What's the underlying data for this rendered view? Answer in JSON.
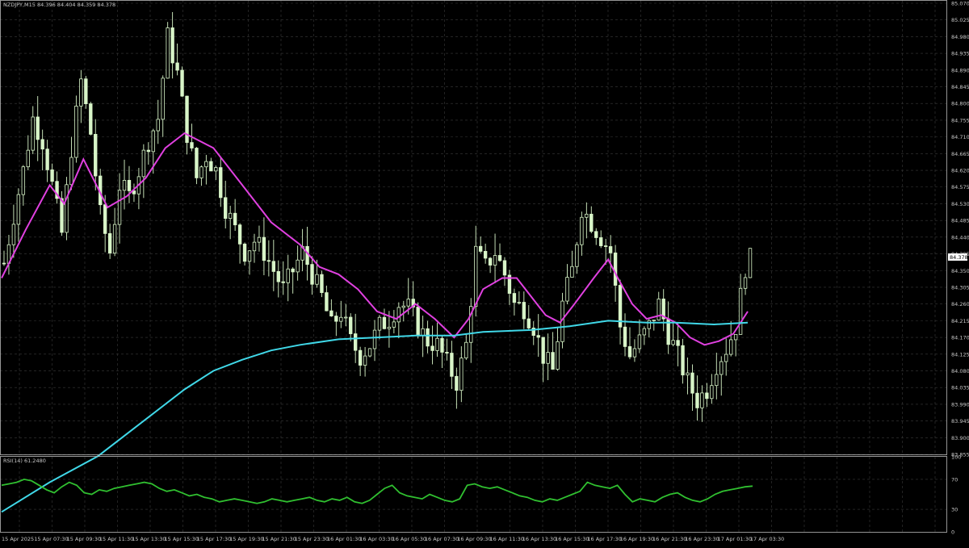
{
  "symbol_header": "NZDJPY,M15  84.396 84.404 84.359 84.378",
  "rsi_header": "RSI(14) 61.2480",
  "current_price_label": "84.378",
  "colors": {
    "background": "#000000",
    "candle": "#d8f5c8",
    "ma_fast": "#e040e0",
    "ma_slow": "#40d8e8",
    "rsi_line": "#30c030",
    "grid": "#3a3a3a"
  },
  "chart_data": [
    {
      "type": "candlestick",
      "title": "NZDJPY,M15",
      "ylim": [
        83.855,
        85.07
      ],
      "y_ticks": [
        "85.070",
        "85.025",
        "84.980",
        "84.935",
        "84.890",
        "84.845",
        "84.800",
        "84.755",
        "84.710",
        "84.665",
        "84.620",
        "84.575",
        "84.530",
        "84.485",
        "84.440",
        "84.395",
        "84.350",
        "84.305",
        "84.260",
        "84.215",
        "84.170",
        "84.125",
        "84.080",
        "84.035",
        "83.990",
        "83.945",
        "83.900",
        "83.855"
      ],
      "x_ticks": [
        "15 Apr 2025",
        "15 Apr 07:30",
        "15 Apr 09:30",
        "15 Apr 11:30",
        "15 Apr 13:30",
        "15 Apr 15:30",
        "15 Apr 17:30",
        "15 Apr 19:30",
        "15 Apr 21:30",
        "15 Apr 23:30",
        "16 Apr 01:30",
        "16 Apr 03:30",
        "16 Apr 05:30",
        "16 Apr 07:30",
        "16 Apr 09:30",
        "16 Apr 11:30",
        "16 Apr 13:30",
        "16 Apr 15:30",
        "16 Apr 17:30",
        "16 Apr 19:30",
        "16 Apr 21:30",
        "16 Apr 23:30",
        "17 Apr 01:30",
        "17 Apr 03:30"
      ],
      "close_path": [
        [
          0,
          84.37
        ],
        [
          2,
          84.5
        ],
        [
          4,
          84.62
        ],
        [
          6,
          84.76
        ],
        [
          8,
          84.7
        ],
        [
          10,
          84.58
        ],
        [
          12,
          84.45
        ],
        [
          14,
          84.68
        ],
        [
          16,
          84.86
        ],
        [
          18,
          84.72
        ],
        [
          20,
          84.5
        ],
        [
          22,
          84.4
        ],
        [
          24,
          84.58
        ],
        [
          26,
          84.55
        ],
        [
          28,
          84.62
        ],
        [
          30,
          84.7
        ],
        [
          32,
          84.76
        ],
        [
          34,
          84.98
        ],
        [
          36,
          84.88
        ],
        [
          38,
          84.72
        ],
        [
          40,
          84.6
        ],
        [
          42,
          84.66
        ],
        [
          44,
          84.62
        ],
        [
          46,
          84.52
        ],
        [
          48,
          84.46
        ],
        [
          50,
          84.4
        ],
        [
          52,
          84.43
        ],
        [
          54,
          84.4
        ],
        [
          56,
          84.35
        ],
        [
          58,
          84.3
        ],
        [
          60,
          84.35
        ],
        [
          62,
          84.4
        ],
        [
          64,
          84.34
        ],
        [
          66,
          84.28
        ],
        [
          68,
          84.2
        ],
        [
          70,
          84.24
        ],
        [
          72,
          84.16
        ],
        [
          74,
          84.12
        ],
        [
          76,
          84.15
        ],
        [
          78,
          84.2
        ],
        [
          80,
          84.22
        ],
        [
          82,
          84.26
        ],
        [
          84,
          84.25
        ],
        [
          86,
          84.2
        ],
        [
          88,
          84.16
        ],
        [
          90,
          84.15
        ],
        [
          92,
          84.1
        ],
        [
          94,
          84.05
        ],
        [
          96,
          84.15
        ],
        [
          98,
          84.4
        ],
        [
          100,
          84.36
        ],
        [
          102,
          84.4
        ],
        [
          104,
          84.34
        ],
        [
          106,
          84.26
        ],
        [
          108,
          84.25
        ],
        [
          110,
          84.2
        ],
        [
          112,
          84.12
        ],
        [
          114,
          84.08
        ],
        [
          116,
          84.26
        ],
        [
          118,
          84.35
        ],
        [
          120,
          84.52
        ],
        [
          122,
          84.48
        ],
        [
          124,
          84.44
        ],
        [
          126,
          84.4
        ],
        [
          128,
          84.2
        ],
        [
          130,
          84.12
        ],
        [
          132,
          84.16
        ],
        [
          134,
          84.2
        ],
        [
          136,
          84.26
        ],
        [
          138,
          84.18
        ],
        [
          140,
          84.12
        ],
        [
          142,
          84.05
        ],
        [
          144,
          84.0
        ],
        [
          146,
          84.03
        ],
        [
          148,
          84.1
        ],
        [
          150,
          84.14
        ],
        [
          152,
          84.2
        ],
        [
          154,
          84.36
        ],
        [
          156,
          84.4
        ]
      ],
      "series": [
        {
          "name": "ma_fast",
          "points": [
            [
              0,
              84.33
            ],
            [
              5,
              84.46
            ],
            [
              10,
              84.58
            ],
            [
              13,
              84.53
            ],
            [
              17,
              84.65
            ],
            [
              22,
              84.52
            ],
            [
              26,
              84.55
            ],
            [
              30,
              84.6
            ],
            [
              34,
              84.68
            ],
            [
              38,
              84.72
            ],
            [
              44,
              84.68
            ],
            [
              50,
              84.58
            ],
            [
              56,
              84.48
            ],
            [
              62,
              84.42
            ],
            [
              66,
              84.36
            ],
            [
              70,
              84.34
            ],
            [
              74,
              84.3
            ],
            [
              78,
              84.24
            ],
            [
              82,
              84.22
            ],
            [
              86,
              84.26
            ],
            [
              90,
              84.22
            ],
            [
              94,
              84.17
            ],
            [
              97,
              84.22
            ],
            [
              100,
              84.3
            ],
            [
              104,
              84.33
            ],
            [
              107,
              84.33
            ],
            [
              110,
              84.28
            ],
            [
              113,
              84.23
            ],
            [
              116,
              84.21
            ],
            [
              119,
              84.26
            ],
            [
              123,
              84.33
            ],
            [
              126,
              84.38
            ],
            [
              128,
              84.33
            ],
            [
              131,
              84.26
            ],
            [
              134,
              84.22
            ],
            [
              137,
              84.23
            ],
            [
              140,
              84.21
            ],
            [
              143,
              84.17
            ],
            [
              146,
              84.15
            ],
            [
              149,
              84.16
            ],
            [
              152,
              84.18
            ],
            [
              155,
              84.24
            ]
          ]
        },
        {
          "name": "ma_slow",
          "points": [
            [
              0,
              83.7
            ],
            [
              10,
              83.78
            ],
            [
              20,
              83.85
            ],
            [
              30,
              83.95
            ],
            [
              38,
              84.03
            ],
            [
              44,
              84.08
            ],
            [
              50,
              84.11
            ],
            [
              56,
              84.135
            ],
            [
              62,
              84.15
            ],
            [
              70,
              84.165
            ],
            [
              78,
              84.17
            ],
            [
              86,
              84.175
            ],
            [
              94,
              84.175
            ],
            [
              100,
              84.185
            ],
            [
              110,
              84.19
            ],
            [
              118,
              84.2
            ],
            [
              126,
              84.215
            ],
            [
              134,
              84.21
            ],
            [
              140,
              84.21
            ],
            [
              148,
              84.205
            ],
            [
              155,
              84.21
            ]
          ]
        }
      ]
    },
    {
      "type": "line",
      "title": "RSI(14) 61.2480",
      "ylim": [
        0,
        100
      ],
      "y_ticks": [
        "100",
        "70",
        "30",
        "0"
      ],
      "levels": [
        70,
        30
      ],
      "series": [
        {
          "name": "RSI(14)",
          "values": [
            62,
            64,
            66,
            70,
            68,
            62,
            56,
            52,
            60,
            66,
            62,
            52,
            50,
            56,
            54,
            58,
            60,
            62,
            64,
            66,
            64,
            58,
            54,
            56,
            52,
            48,
            50,
            46,
            44,
            40,
            42,
            44,
            42,
            40,
            38,
            40,
            44,
            42,
            40,
            42,
            44,
            46,
            42,
            40,
            44,
            42,
            46,
            40,
            38,
            42,
            50,
            58,
            62,
            52,
            48,
            46,
            44,
            50,
            46,
            42,
            40,
            44,
            62,
            64,
            60,
            58,
            60,
            56,
            52,
            48,
            46,
            42,
            40,
            44,
            42,
            46,
            50,
            54,
            66,
            62,
            60,
            58,
            62,
            50,
            40,
            44,
            42,
            40,
            46,
            50,
            52,
            46,
            42,
            40,
            44,
            50,
            54,
            56,
            58,
            60,
            61
          ]
        }
      ]
    }
  ]
}
